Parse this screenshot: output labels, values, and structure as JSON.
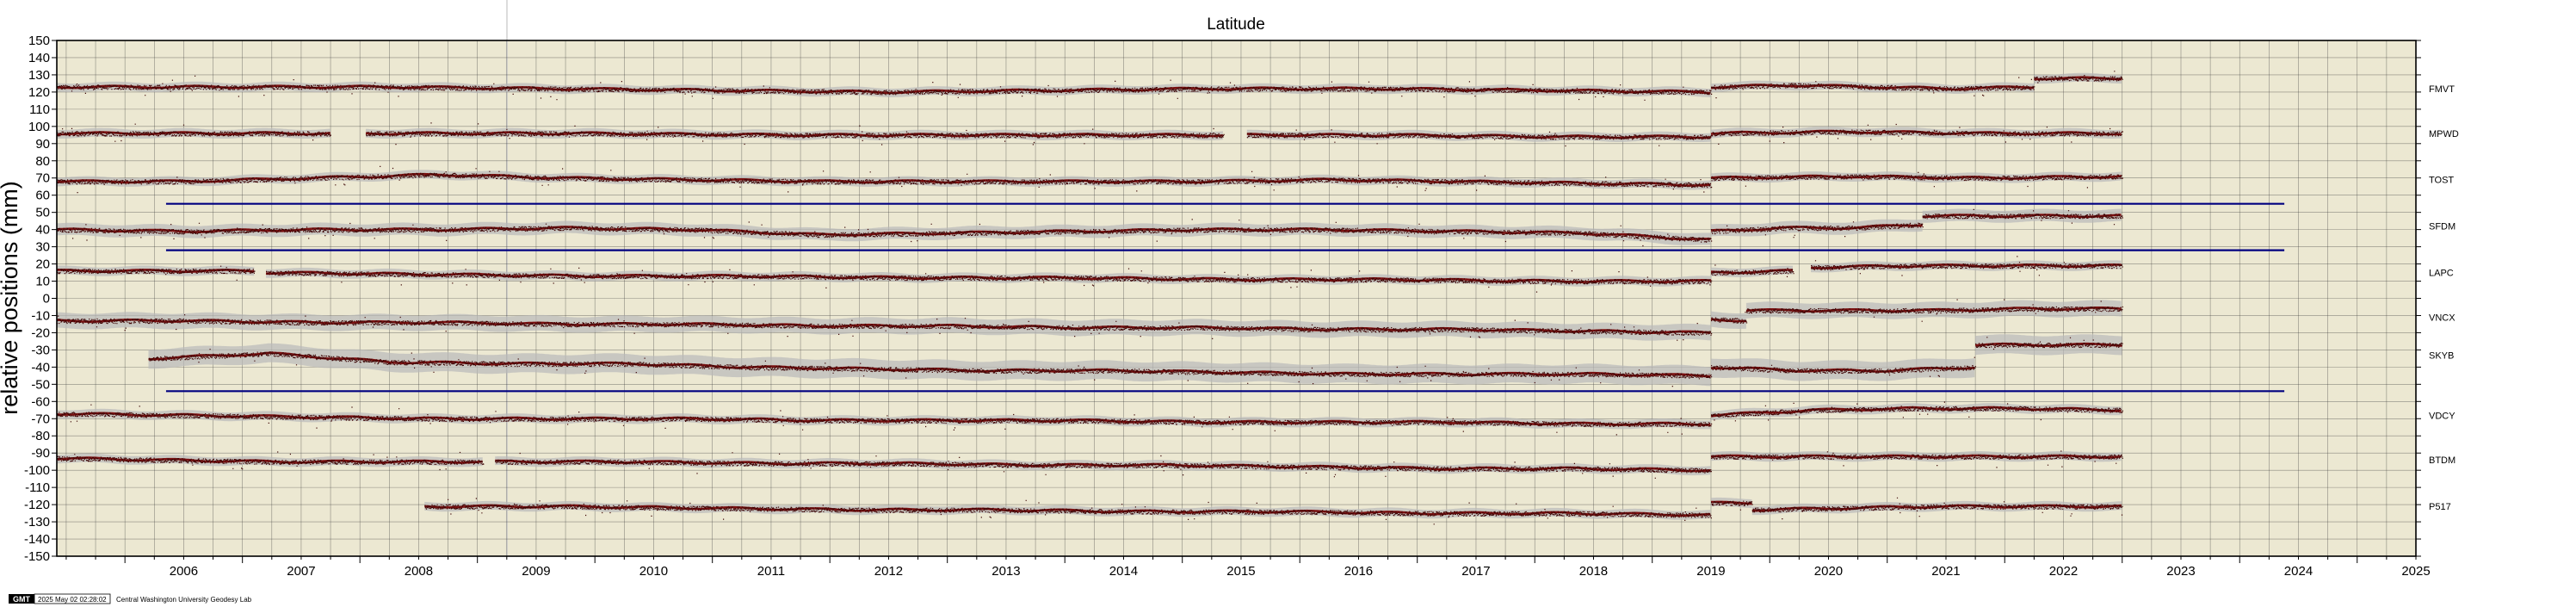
{
  "chart_data": {
    "type": "scatter",
    "title": "Latitude",
    "ylabel": "relative positions (mm)",
    "xlabel": "",
    "xlim": [
      2005.42,
      2025.5
    ],
    "ylim": [
      -150,
      150
    ],
    "grid": true,
    "y_ticks": [
      "150",
      "140",
      "130",
      "120",
      "110",
      "100",
      "90",
      "80",
      "70",
      "60",
      "50",
      "40",
      "30",
      "20",
      "10",
      "0",
      "-10",
      "-20",
      "-30",
      "-40",
      "-50",
      "-60",
      "-70",
      "-80",
      "-90",
      "-100",
      "-110",
      "-120",
      "-130",
      "-140",
      "-150"
    ],
    "x_ticks": [
      "2006",
      "2007",
      "2008",
      "2009",
      "2010",
      "2011",
      "2012",
      "2013",
      "2014",
      "2015",
      "2016",
      "2017",
      "2018",
      "2019",
      "2020",
      "2021",
      "2022",
      "2023",
      "2024",
      "2025"
    ],
    "colors": {
      "plot_bg": "#ece8d2",
      "grid": "#3a3a3a",
      "points": "#7a1010",
      "error_band": "#b9b9b9",
      "reference_line": "#000080",
      "cursor_line": "#d0d0d0"
    },
    "reference_lines": [
      {
        "y": 55,
        "x": [
          2006.35,
          2024.38
        ]
      },
      {
        "y": 28,
        "x": [
          2006.35,
          2024.38
        ]
      },
      {
        "y": -54,
        "x": [
          2006.35,
          2024.38
        ]
      }
    ],
    "series": [
      {
        "name": "FMVT",
        "label_y": 122,
        "band": 2.5,
        "segments": [
          {
            "x": [
              2005.42,
              2019.5
            ],
            "y": [
              123,
              123,
              123,
              122,
              121,
              120,
              121,
              122,
              122,
              121,
              120
            ]
          },
          {
            "x": [
              2019.5,
              2022.25
            ],
            "y": [
              123,
              124,
              123,
              122,
              123
            ]
          },
          {
            "x": [
              2022.25,
              2023.0
            ],
            "y": [
              128,
              128
            ]
          }
        ]
      },
      {
        "name": "MPWD",
        "label_y": 96,
        "band": 2.5,
        "segments": [
          {
            "x": [
              2005.42,
              2007.75
            ],
            "y": [
              96,
              96
            ]
          },
          {
            "x": [
              2008.05,
              2015.35
            ],
            "y": [
              96,
              96,
              95,
              95,
              95
            ]
          },
          {
            "x": [
              2015.55,
              2019.5
            ],
            "y": [
              95,
              95,
              94,
              94
            ]
          },
          {
            "x": [
              2019.5,
              2023.0
            ],
            "y": [
              96,
              97,
              96,
              96
            ]
          }
        ]
      },
      {
        "name": "TOST",
        "label_y": 69,
        "band": 2.5,
        "segments": [
          {
            "x": [
              2005.42,
              2019.5
            ],
            "y": [
              68,
              68,
              70,
              72,
              70,
              69,
              68,
              68,
              68,
              68,
              69,
              68,
              67,
              66
            ]
          },
          {
            "x": [
              2019.5,
              2023.0
            ],
            "y": [
              70,
              71,
              70,
              71
            ]
          }
        ]
      },
      {
        "name": "SFDM",
        "label_y": 42,
        "band": 3.5,
        "segments": [
          {
            "x": [
              2005.42,
              2019.5
            ],
            "y": [
              40,
              39,
              40,
              40,
              41,
              40,
              37,
              38,
              39,
              40,
              40,
              39,
              38,
              34
            ]
          },
          {
            "x": [
              2019.5,
              2021.3
            ],
            "y": [
              39,
              41,
              41,
              43
            ]
          },
          {
            "x": [
              2021.3,
              2023.0
            ],
            "y": [
              48,
              48,
              48
            ]
          }
        ]
      },
      {
        "name": "LAPC",
        "label_y": 15,
        "band": 2.5,
        "segments": [
          {
            "x": [
              2005.42,
              2007.1
            ],
            "y": [
              16,
              16,
              16
            ]
          },
          {
            "x": [
              2007.2,
              2019.5
            ],
            "y": [
              15,
              14,
              13,
              13,
              12,
              12,
              11,
              11,
              10,
              10
            ]
          },
          {
            "x": [
              2019.5,
              2020.2
            ],
            "y": [
              15,
              16
            ]
          },
          {
            "x": [
              2020.35,
              2023.0
            ],
            "y": [
              18,
              19,
              19,
              19
            ]
          }
        ]
      },
      {
        "name": "VNCX",
        "label_y": -11,
        "band": 4.5,
        "segments": [
          {
            "x": [
              2005.42,
              2019.5
            ],
            "y": [
              -13,
              -13,
              -14,
              -14,
              -15,
              -15,
              -16,
              -16,
              -17,
              -17,
              -18,
              -18,
              -19,
              -20
            ]
          },
          {
            "x": [
              2019.5,
              2019.8
            ],
            "y": [
              -12,
              -13
            ]
          },
          {
            "x": [
              2019.8,
              2023.0
            ],
            "y": [
              -7,
              -7,
              -7,
              -6,
              -6
            ]
          }
        ]
      },
      {
        "name": "SKYB",
        "label_y": -33,
        "band": 5.5,
        "segments": [
          {
            "x": [
              2006.2,
              2019.5
            ],
            "y": [
              -35,
              -32,
              -37,
              -38,
              -38,
              -40,
              -41,
              -42,
              -42,
              -43,
              -44,
              -44,
              -44,
              -45
            ]
          },
          {
            "x": [
              2019.5,
              2021.75
            ],
            "y": [
              -40,
              -42,
              -42,
              -40
            ]
          },
          {
            "x": [
              2021.75,
              2023.0
            ],
            "y": [
              -27,
              -27,
              -27
            ]
          }
        ]
      },
      {
        "name": "VDCY",
        "label_y": -68,
        "band": 2.5,
        "segments": [
          {
            "x": [
              2005.42,
              2019.5
            ],
            "y": [
              -67,
              -68,
              -69,
              -70,
              -70,
              -70,
              -71,
              -71,
              -71,
              -72,
              -72,
              -72,
              -73,
              -73
            ]
          },
          {
            "x": [
              2019.5,
              2023.0
            ],
            "y": [
              -68,
              -65,
              -64,
              -64,
              -65
            ]
          }
        ]
      },
      {
        "name": "BTDM",
        "label_y": -94,
        "band": 2.5,
        "segments": [
          {
            "x": [
              2005.42,
              2009.05
            ],
            "y": [
              -93,
              -95,
              -95
            ]
          },
          {
            "x": [
              2009.15,
              2019.5
            ],
            "y": [
              -95,
              -95,
              -96,
              -96,
              -97,
              -97,
              -98,
              -99,
              -99,
              -100
            ]
          },
          {
            "x": [
              2019.5,
              2023.0
            ],
            "y": [
              -92,
              -92,
              -92,
              -92,
              -92
            ]
          }
        ]
      },
      {
        "name": "P517",
        "label_y": -121,
        "band": 2.5,
        "segments": [
          {
            "x": [
              2008.55,
              2019.5
            ],
            "y": [
              -121,
              -121,
              -122,
              -123,
              -123,
              -124,
              -124,
              -125,
              -125,
              -126
            ]
          },
          {
            "x": [
              2019.5,
              2019.85
            ],
            "y": [
              -119,
              -119
            ]
          },
          {
            "x": [
              2019.85,
              2023.0
            ],
            "y": [
              -123,
              -122,
              -121,
              -121,
              -121
            ]
          }
        ]
      }
    ]
  },
  "footer": {
    "logo": "GMT",
    "timestamp": "2025 May 02 02:28:02",
    "credit": "Central Washington University Geodesy Lab"
  }
}
